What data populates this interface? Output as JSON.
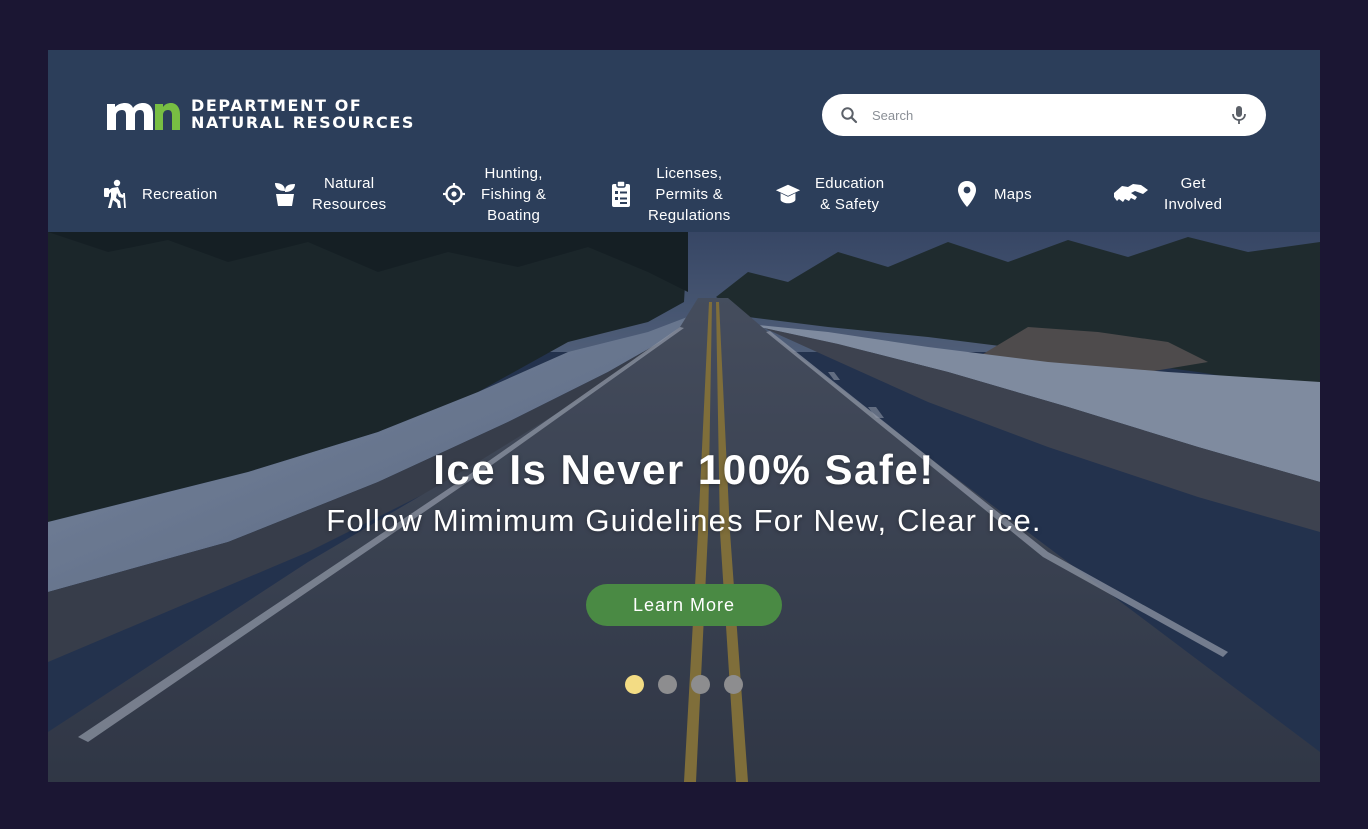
{
  "header": {
    "logo_line1": "DEPARTMENT OF",
    "logo_line2": "NATURAL RESOURCES",
    "logo_mark_text": "mn",
    "search": {
      "placeholder": "Search",
      "value": ""
    }
  },
  "nav": [
    {
      "label": "Recreation",
      "icon": "hiker-icon"
    },
    {
      "label": "Natural\nResources",
      "icon": "seedling-icon"
    },
    {
      "label": "Hunting,\nFishing &\nBoating",
      "icon": "crosshair-icon"
    },
    {
      "label": "Licenses,\nPermits &\nRegulations",
      "icon": "clipboard-icon"
    },
    {
      "label": "Education\n& Safety",
      "icon": "graduation-cap-icon"
    },
    {
      "label": "Maps",
      "icon": "map-pin-icon"
    },
    {
      "label": "Get\nInvolved",
      "icon": "handshake-icon"
    }
  ],
  "hero": {
    "title": "Ice Is Never 100% Safe!",
    "subtitle": "Follow Mimimum Guidelines For New, Clear Ice.",
    "cta_label": "Learn More",
    "slide_count": 4,
    "active_slide": 1
  },
  "colors": {
    "page_background": "#1b1633",
    "header_background": "#2c3e5a",
    "cta_green": "#4a8a44",
    "logo_green": "#78be43",
    "dot_active": "#f3dc84",
    "dot_inactive": "#8d8d8f"
  }
}
